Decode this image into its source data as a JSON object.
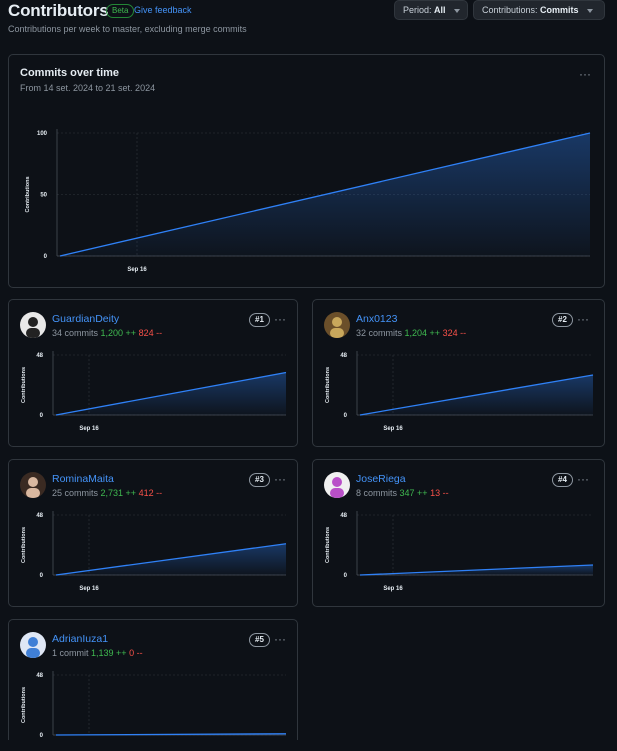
{
  "header": {
    "title": "Contributors",
    "beta": "Beta",
    "feedback": "Give feedback",
    "subtitle": "Contributions per week to master, excluding merge commits",
    "period_label": "Period:",
    "period_value": "All",
    "contrib_label": "Contributions:",
    "contrib_value": "Commits"
  },
  "overview": {
    "title": "Commits over time",
    "subtitle": "From 14 set. 2024 to 21 set. 2024",
    "ylabel": "Contributions",
    "xtick": "Sep 16",
    "yticks": [
      "100",
      "50",
      "0"
    ]
  },
  "contributors": [
    {
      "name": "GuardianDeity",
      "commits": "34 commits",
      "additions": "1,200 ++",
      "deletions": "824 --",
      "rank": "#1"
    },
    {
      "name": "Anx0123",
      "commits": "32 commits",
      "additions": "1,204 ++",
      "deletions": "324 --",
      "rank": "#2"
    },
    {
      "name": "RominaMaita",
      "commits": "25 commits",
      "additions": "2,731 ++",
      "deletions": "412 --",
      "rank": "#3"
    },
    {
      "name": "JoseRiega",
      "commits": "8 commits",
      "additions": "347 ++",
      "deletions": "13 --",
      "rank": "#4"
    },
    {
      "name": "AdrianIuza1",
      "commits": "1 commit",
      "additions": "1,139 ++",
      "deletions": "0 --",
      "rank": "#5"
    }
  ],
  "mini_chart": {
    "ylabel": "Contributions",
    "ytop": "48",
    "ybottom": "0",
    "xtick": "Sep 16"
  },
  "colors": {
    "line": "#2f81f7",
    "link": "#4493f8",
    "add": "#3fb950",
    "del": "#f85149"
  },
  "chart_data": [
    {
      "type": "area",
      "title": "Commits over time",
      "ylabel": "Contributions",
      "ylim": [
        0,
        100
      ],
      "x": [
        "14 set. 2024",
        "21 set. 2024"
      ],
      "values": [
        0,
        100
      ],
      "xticks": [
        "Sep 16"
      ]
    },
    {
      "type": "area",
      "title": "GuardianDeity",
      "ylabel": "Contributions",
      "ylim": [
        0,
        48
      ],
      "x": [
        "14 set. 2024",
        "21 set. 2024"
      ],
      "values": [
        0,
        34
      ]
    },
    {
      "type": "area",
      "title": "Anx0123",
      "ylabel": "Contributions",
      "ylim": [
        0,
        48
      ],
      "x": [
        "14 set. 2024",
        "21 set. 2024"
      ],
      "values": [
        0,
        32
      ]
    },
    {
      "type": "area",
      "title": "RominaMaita",
      "ylabel": "Contributions",
      "ylim": [
        0,
        48
      ],
      "x": [
        "14 set. 2024",
        "21 set. 2024"
      ],
      "values": [
        0,
        25
      ]
    },
    {
      "type": "area",
      "title": "JoseRiega",
      "ylabel": "Contributions",
      "ylim": [
        0,
        48
      ],
      "x": [
        "14 set. 2024",
        "21 set. 2024"
      ],
      "values": [
        0,
        8
      ]
    },
    {
      "type": "area",
      "title": "AdrianIuza1",
      "ylabel": "Contributions",
      "ylim": [
        0,
        48
      ],
      "x": [
        "14 set. 2024",
        "21 set. 2024"
      ],
      "values": [
        0,
        1
      ]
    }
  ]
}
